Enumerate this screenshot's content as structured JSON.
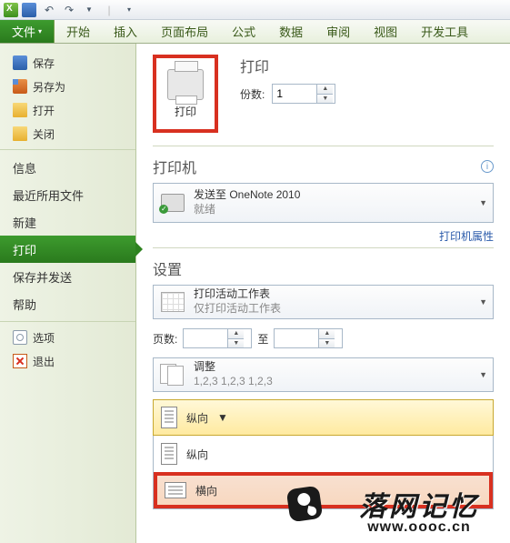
{
  "qat": {
    "save": "保存",
    "undo": "↶",
    "redo": "↷"
  },
  "tabs": {
    "file": "文件",
    "home": "开始",
    "insert": "插入",
    "layout": "页面布局",
    "formula": "公式",
    "data": "数据",
    "review": "审阅",
    "view": "视图",
    "dev": "开发工具"
  },
  "sidebar": {
    "save": "保存",
    "saveas": "另存为",
    "open": "打开",
    "close": "关闭",
    "info": "信息",
    "recent": "最近所用文件",
    "new": "新建",
    "print": "打印",
    "share": "保存并发送",
    "help": "帮助",
    "options": "选项",
    "exit": "退出"
  },
  "print": {
    "header": "打印",
    "button": "打印",
    "copies_label": "份数:",
    "copies_value": "1",
    "printer_header": "打印机",
    "printer_name": "发送至 OneNote 2010",
    "printer_status": "就绪",
    "printer_props": "打印机属性",
    "settings_header": "设置",
    "scope_title": "打印活动工作表",
    "scope_sub": "仅打印活动工作表",
    "pages_label": "页数:",
    "pages_to": "至",
    "collate_title": "调整",
    "collate_sub": "1,2,3    1,2,3    1,2,3",
    "orient_current": "纵向",
    "orient_portrait": "纵向",
    "orient_landscape": "横向"
  },
  "logo": {
    "cn": "落网记忆",
    "url": "www.oooc.cn"
  }
}
